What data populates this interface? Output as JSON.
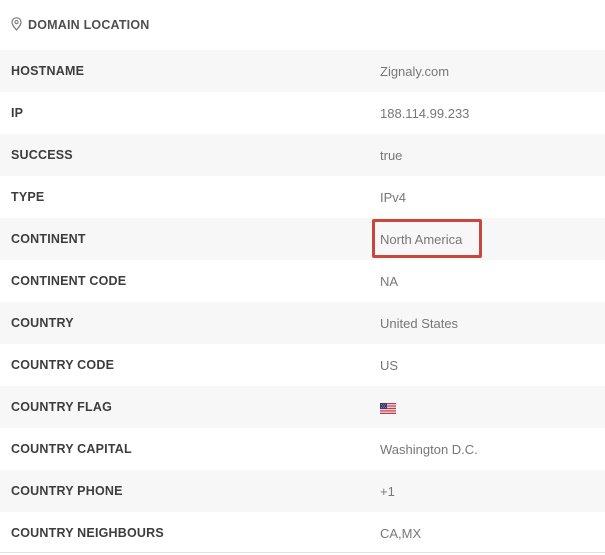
{
  "header": {
    "icon": "map-pin-icon",
    "title": "DOMAIN LOCATION"
  },
  "rows": [
    {
      "key": "HOSTNAME",
      "value": "Zignaly.com"
    },
    {
      "key": "IP",
      "value": "188.114.99.233"
    },
    {
      "key": "SUCCESS",
      "value": "true"
    },
    {
      "key": "TYPE",
      "value": "IPv4"
    },
    {
      "key": "CONTINENT",
      "value": "North America"
    },
    {
      "key": "CONTINENT CODE",
      "value": "NA"
    },
    {
      "key": "COUNTRY",
      "value": "United States"
    },
    {
      "key": "COUNTRY CODE",
      "value": "US"
    },
    {
      "key": "COUNTRY FLAG",
      "value": "",
      "icon": "us-flag-icon"
    },
    {
      "key": "COUNTRY CAPITAL",
      "value": "Washington D.C."
    },
    {
      "key": "COUNTRY PHONE",
      "value": "+1"
    },
    {
      "key": "COUNTRY NEIGHBOURS",
      "value": "CA,MX"
    }
  ],
  "highlight": {
    "row": "CONTINENT",
    "color": "#c9463d"
  },
  "colors": {
    "stripe": "#f7f7f7",
    "label": "#3d3d3d",
    "value": "#777777"
  }
}
